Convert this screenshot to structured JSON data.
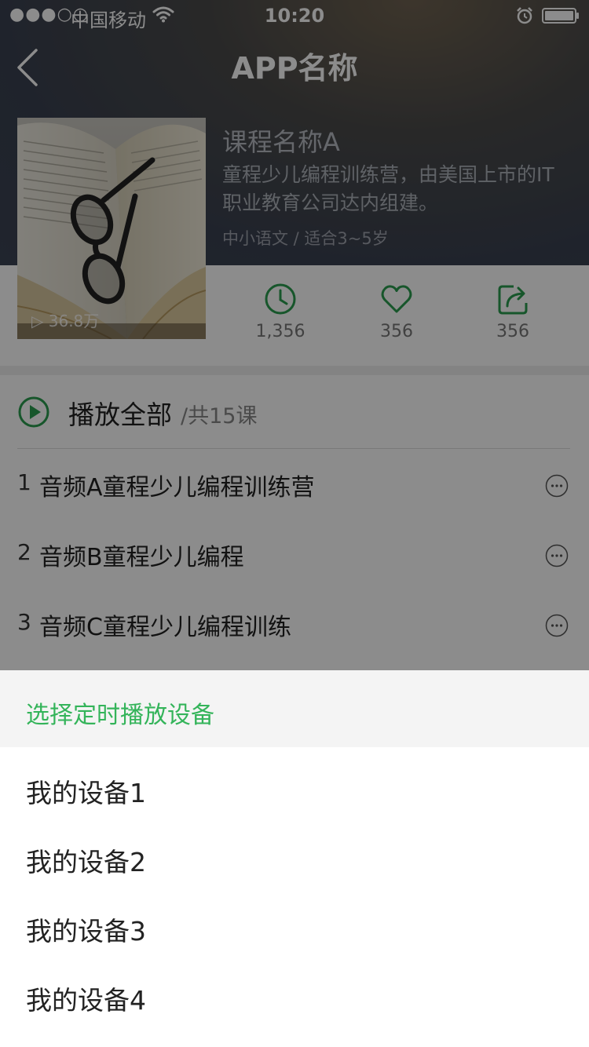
{
  "status_bar": {
    "signal": "●●●○○",
    "carrier": "中国移动",
    "time": "10:20"
  },
  "nav": {
    "title": "APP名称",
    "back_icon": "back-chevron-icon"
  },
  "course": {
    "cover_play_count": "▷ 36.8万",
    "name": "课程名称A",
    "description": "童程少儿编程训练营，由美国上市的IT职业教育公司达内组建。",
    "meta": "中小语文 / 适合3~5岁"
  },
  "stats": [
    {
      "icon": "clock-icon",
      "value": "1,356"
    },
    {
      "icon": "heart-icon",
      "value": "356"
    },
    {
      "icon": "share-icon",
      "value": "356"
    }
  ],
  "playlist": {
    "play_all_label": "播放全部",
    "count_label": "/共15课",
    "tracks": [
      {
        "num": "1",
        "title": "音频A童程少儿编程训练营"
      },
      {
        "num": "2",
        "title": "音频B童程少儿编程"
      },
      {
        "num": "3",
        "title": "音频C童程少儿编程训练"
      }
    ]
  },
  "sheet": {
    "title": "选择定时播放设备",
    "devices": [
      "我的设备1",
      "我的设备2",
      "我的设备3",
      "我的设备4"
    ]
  },
  "colors": {
    "accent_green": "#34b45a",
    "icon_green": "#2a9d4f"
  }
}
